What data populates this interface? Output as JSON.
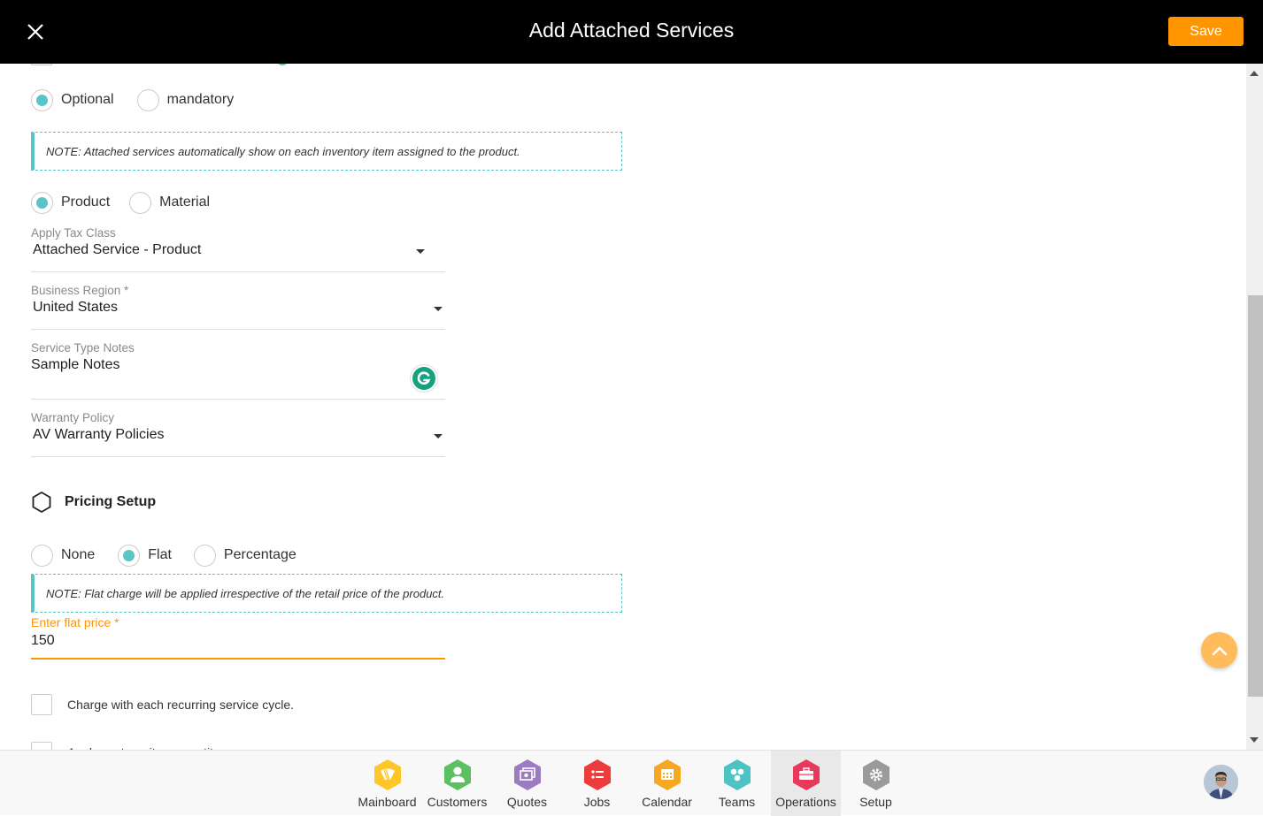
{
  "header": {
    "title": "Add Attached Services",
    "save_label": "Save",
    "close_icon": "close-icon"
  },
  "form": {
    "requirement_options": [
      {
        "label": "Optional",
        "checked": true
      },
      {
        "label": "mandatory",
        "checked": false
      }
    ],
    "note_attached": "NOTE: Attached services automatically show on each inventory item assigned to the product.",
    "type_options": [
      {
        "label": "Product",
        "checked": true
      },
      {
        "label": "Material",
        "checked": false
      }
    ],
    "tax_class": {
      "label": "Apply Tax Class",
      "value": "Attached Service - Product"
    },
    "business_region": {
      "label": "Business Region *",
      "value": "United States"
    },
    "service_notes": {
      "label": "Service Type Notes",
      "value": "Sample Notes"
    },
    "warranty_policy": {
      "label": "Warranty Policy",
      "value": "AV Warranty Policies"
    },
    "pricing_section_title": "Pricing Setup",
    "pricing_options": [
      {
        "label": "None",
        "checked": false
      },
      {
        "label": "Flat",
        "checked": true
      },
      {
        "label": "Percentage",
        "checked": false
      }
    ],
    "note_flat": "NOTE: Flat charge will be applied irrespective of the retail price of the product.",
    "flat_price": {
      "label": "Enter flat price *",
      "value": "150"
    },
    "checkboxes": [
      {
        "label": "Charge with each recurring service cycle.",
        "checked": false
      },
      {
        "label": "Apply cost per item quantity",
        "checked": false
      }
    ]
  },
  "bottom_nav": {
    "items": [
      {
        "label": "Mainboard",
        "icon": "mainboard-icon",
        "color": "#ffc629",
        "active": false
      },
      {
        "label": "Customers",
        "icon": "customers-icon",
        "color": "#5cbf60",
        "active": false
      },
      {
        "label": "Quotes",
        "icon": "quotes-icon",
        "color": "#9b7bc1",
        "active": false
      },
      {
        "label": "Jobs",
        "icon": "jobs-icon",
        "color": "#ee3b3b",
        "active": false
      },
      {
        "label": "Calendar",
        "icon": "calendar-icon",
        "color": "#f7a823",
        "active": false
      },
      {
        "label": "Teams",
        "icon": "teams-icon",
        "color": "#4dc3c3",
        "active": false
      },
      {
        "label": "Operations",
        "icon": "operations-icon",
        "color": "#e9395b",
        "active": true
      },
      {
        "label": "Setup",
        "icon": "setup-icon",
        "color": "#9a9a9a",
        "active": false
      }
    ]
  },
  "colors": {
    "accent": "#ff9500",
    "teal": "#5ac5c5"
  }
}
